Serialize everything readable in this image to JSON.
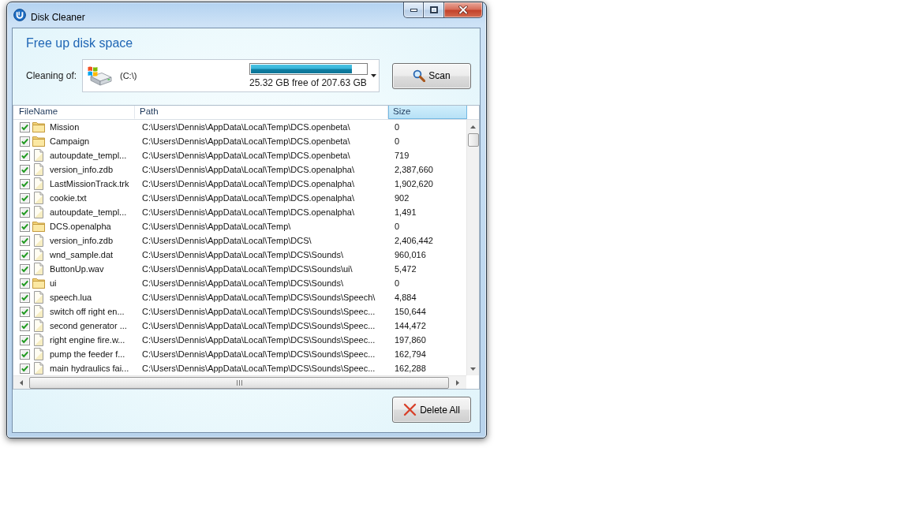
{
  "window": {
    "title": "Disk Cleaner"
  },
  "heading": "Free up disk space",
  "drive_picker": {
    "label": "Cleaning of:",
    "drive": "(C:\\)",
    "level": 0.88,
    "free_space": "25.32 GB free of 207.63 GB"
  },
  "scan_button": {
    "label": "Scan"
  },
  "table": {
    "columns": [
      {
        "label": "FileName",
        "selected": false
      },
      {
        "label": "Path",
        "selected": false
      },
      {
        "label": "Size",
        "selected": true
      }
    ],
    "rows": [
      {
        "checked": true,
        "kind": "folder",
        "name": "Mission",
        "path": "C:\\Users\\Dennis\\AppData\\Local\\Temp\\DCS.openbeta\\",
        "size": "0"
      },
      {
        "checked": true,
        "kind": "folder",
        "name": "Campaign",
        "path": "C:\\Users\\Dennis\\AppData\\Local\\Temp\\DCS.openbeta\\",
        "size": "0"
      },
      {
        "checked": true,
        "kind": "file",
        "name": "autoupdate_templ...",
        "path": "C:\\Users\\Dennis\\AppData\\Local\\Temp\\DCS.openbeta\\",
        "size": "719"
      },
      {
        "checked": true,
        "kind": "file",
        "name": "version_info.zdb",
        "path": "C:\\Users\\Dennis\\AppData\\Local\\Temp\\DCS.openalpha\\",
        "size": "2,387,660"
      },
      {
        "checked": true,
        "kind": "file",
        "name": "LastMissionTrack.trk",
        "path": "C:\\Users\\Dennis\\AppData\\Local\\Temp\\DCS.openalpha\\",
        "size": "1,902,620"
      },
      {
        "checked": true,
        "kind": "file",
        "name": "cookie.txt",
        "path": "C:\\Users\\Dennis\\AppData\\Local\\Temp\\DCS.openalpha\\",
        "size": "902"
      },
      {
        "checked": true,
        "kind": "file",
        "name": "autoupdate_templ...",
        "path": "C:\\Users\\Dennis\\AppData\\Local\\Temp\\DCS.openalpha\\",
        "size": "1,491"
      },
      {
        "checked": true,
        "kind": "folder",
        "name": "DCS.openalpha",
        "path": "C:\\Users\\Dennis\\AppData\\Local\\Temp\\",
        "size": "0"
      },
      {
        "checked": true,
        "kind": "file",
        "name": "version_info.zdb",
        "path": "C:\\Users\\Dennis\\AppData\\Local\\Temp\\DCS\\",
        "size": "2,406,442"
      },
      {
        "checked": true,
        "kind": "file",
        "name": "wnd_sample.dat",
        "path": "C:\\Users\\Dennis\\AppData\\Local\\Temp\\DCS\\Sounds\\",
        "size": "960,016"
      },
      {
        "checked": true,
        "kind": "file",
        "name": "ButtonUp.wav",
        "path": "C:\\Users\\Dennis\\AppData\\Local\\Temp\\DCS\\Sounds\\ui\\",
        "size": "5,472"
      },
      {
        "checked": true,
        "kind": "folder",
        "name": "ui",
        "path": "C:\\Users\\Dennis\\AppData\\Local\\Temp\\DCS\\Sounds\\",
        "size": "0"
      },
      {
        "checked": true,
        "kind": "file",
        "name": "speech.lua",
        "path": "C:\\Users\\Dennis\\AppData\\Local\\Temp\\DCS\\Sounds\\Speech\\",
        "size": "4,884"
      },
      {
        "checked": true,
        "kind": "file",
        "name": "switch off right en...",
        "path": "C:\\Users\\Dennis\\AppData\\Local\\Temp\\DCS\\Sounds\\Speec...",
        "size": "150,644"
      },
      {
        "checked": true,
        "kind": "file",
        "name": "second generator ...",
        "path": "C:\\Users\\Dennis\\AppData\\Local\\Temp\\DCS\\Sounds\\Speec...",
        "size": "144,472"
      },
      {
        "checked": true,
        "kind": "file",
        "name": "right engine fire.w...",
        "path": "C:\\Users\\Dennis\\AppData\\Local\\Temp\\DCS\\Sounds\\Speec...",
        "size": "197,860"
      },
      {
        "checked": true,
        "kind": "file",
        "name": "pump the feeder f...",
        "path": "C:\\Users\\Dennis\\AppData\\Local\\Temp\\DCS\\Sounds\\Speec...",
        "size": "162,794"
      },
      {
        "checked": true,
        "kind": "file",
        "name": "main hydraulics fai...",
        "path": "C:\\Users\\Dennis\\AppData\\Local\\Temp\\DCS\\Sounds\\Speec...",
        "size": "162,288"
      }
    ]
  },
  "delete_button": {
    "label": "Delete All"
  }
}
